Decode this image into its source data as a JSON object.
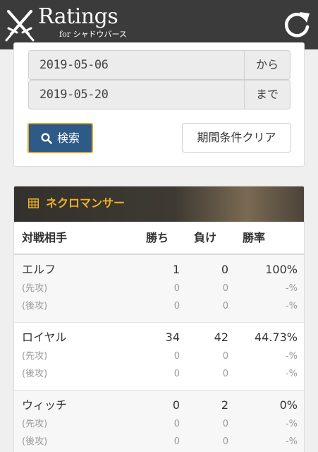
{
  "app": {
    "brand": "Ratings",
    "brand_sub": "for シャドウバース"
  },
  "filter": {
    "date_from": "2019-05-06",
    "from_label": "から",
    "date_to": "2019-05-20",
    "to_label": "まで",
    "search_label": "検索",
    "clear_label": "期間条件クリア"
  },
  "stats": {
    "title": "ネクロマンサー",
    "headers": {
      "opponent": "対戦相手",
      "wins": "勝ち",
      "losses": "負け",
      "rate": "勝率"
    },
    "rows": [
      {
        "opponent": "エルフ",
        "wins": "1",
        "losses": "0",
        "rate": "100%",
        "first": {
          "label": "(先攻)",
          "wins": "0",
          "losses": "0",
          "rate": "-%"
        },
        "second": {
          "label": "(後攻)",
          "wins": "0",
          "losses": "0",
          "rate": "-%"
        }
      },
      {
        "opponent": "ロイヤル",
        "wins": "34",
        "losses": "42",
        "rate": "44.73%",
        "first": {
          "label": "(先攻)",
          "wins": "0",
          "losses": "0",
          "rate": "-%"
        },
        "second": {
          "label": "(後攻)",
          "wins": "0",
          "losses": "0",
          "rate": "-%"
        }
      },
      {
        "opponent": "ウィッチ",
        "wins": "0",
        "losses": "2",
        "rate": "0%",
        "first": {
          "label": "(先攻)",
          "wins": "0",
          "losses": "0",
          "rate": "-%"
        },
        "second": {
          "label": "(後攻)",
          "wins": "0",
          "losses": "0",
          "rate": "-%"
        }
      }
    ]
  },
  "colors": {
    "appbar": "#3b3b3b",
    "accent": "#f2b224",
    "primary": "#2e5a88"
  },
  "icons": {
    "logo": "crossed-swords-icon",
    "refresh": "refresh-icon",
    "search": "search-icon",
    "table": "table-icon"
  }
}
